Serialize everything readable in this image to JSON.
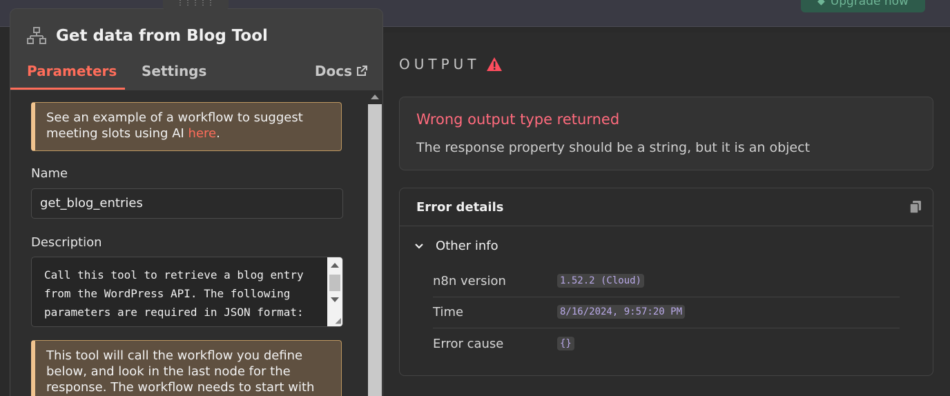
{
  "topbar": {
    "upgrade_label": "Upgrade now"
  },
  "node": {
    "title": "Get data from Blog Tool",
    "tabs": [
      "Parameters",
      "Settings"
    ],
    "docs_label": "Docs"
  },
  "params": {
    "notice1_text": "See an example of a workflow to suggest meeting slots using AI ",
    "notice1_link": "here",
    "notice1_end": ".",
    "name_label": "Name",
    "name_value": "get_blog_entries",
    "description_label": "Description",
    "description_value": "Call this tool to retrieve a blog entry\nfrom the WordPress API. The following\nparameters are required in JSON format:",
    "notice2_text": "This tool will call the workflow you define below, and look in the last node for the response. The workflow needs to start with an Execute"
  },
  "output": {
    "title": "OUTPUT",
    "error_title": "Wrong output type returned",
    "error_message": "The response property should be a string, but it is an object",
    "details_title": "Error details",
    "other_info_label": "Other info",
    "rows": [
      {
        "key": "n8n version",
        "value": "1.52.2 (Cloud)"
      },
      {
        "key": "Time",
        "value": "8/16/2024, 9:57:20 PM"
      },
      {
        "key": "Error cause",
        "value": "{}"
      }
    ]
  },
  "colors": {
    "accent": "#ff6d5a",
    "error": "#ff6b7d",
    "notice_border": "#f1c48f"
  }
}
